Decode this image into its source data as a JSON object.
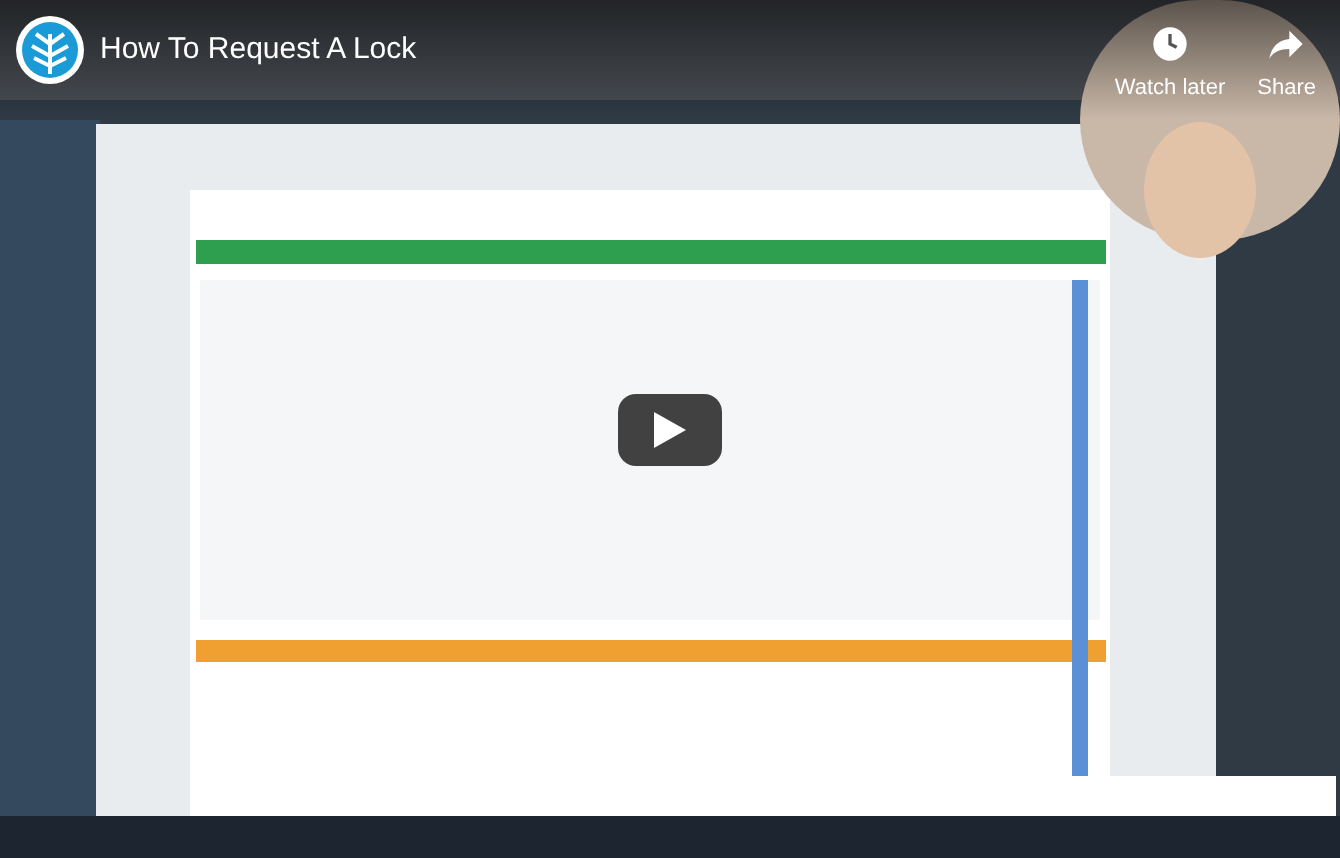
{
  "video": {
    "title": "How To Request A Lock",
    "kind": "picture"
  },
  "actions": [
    {
      "kind": "watch_later",
      "label": "Watch later"
    },
    {
      "kind": "share",
      "label": "Share"
    }
  ]
}
